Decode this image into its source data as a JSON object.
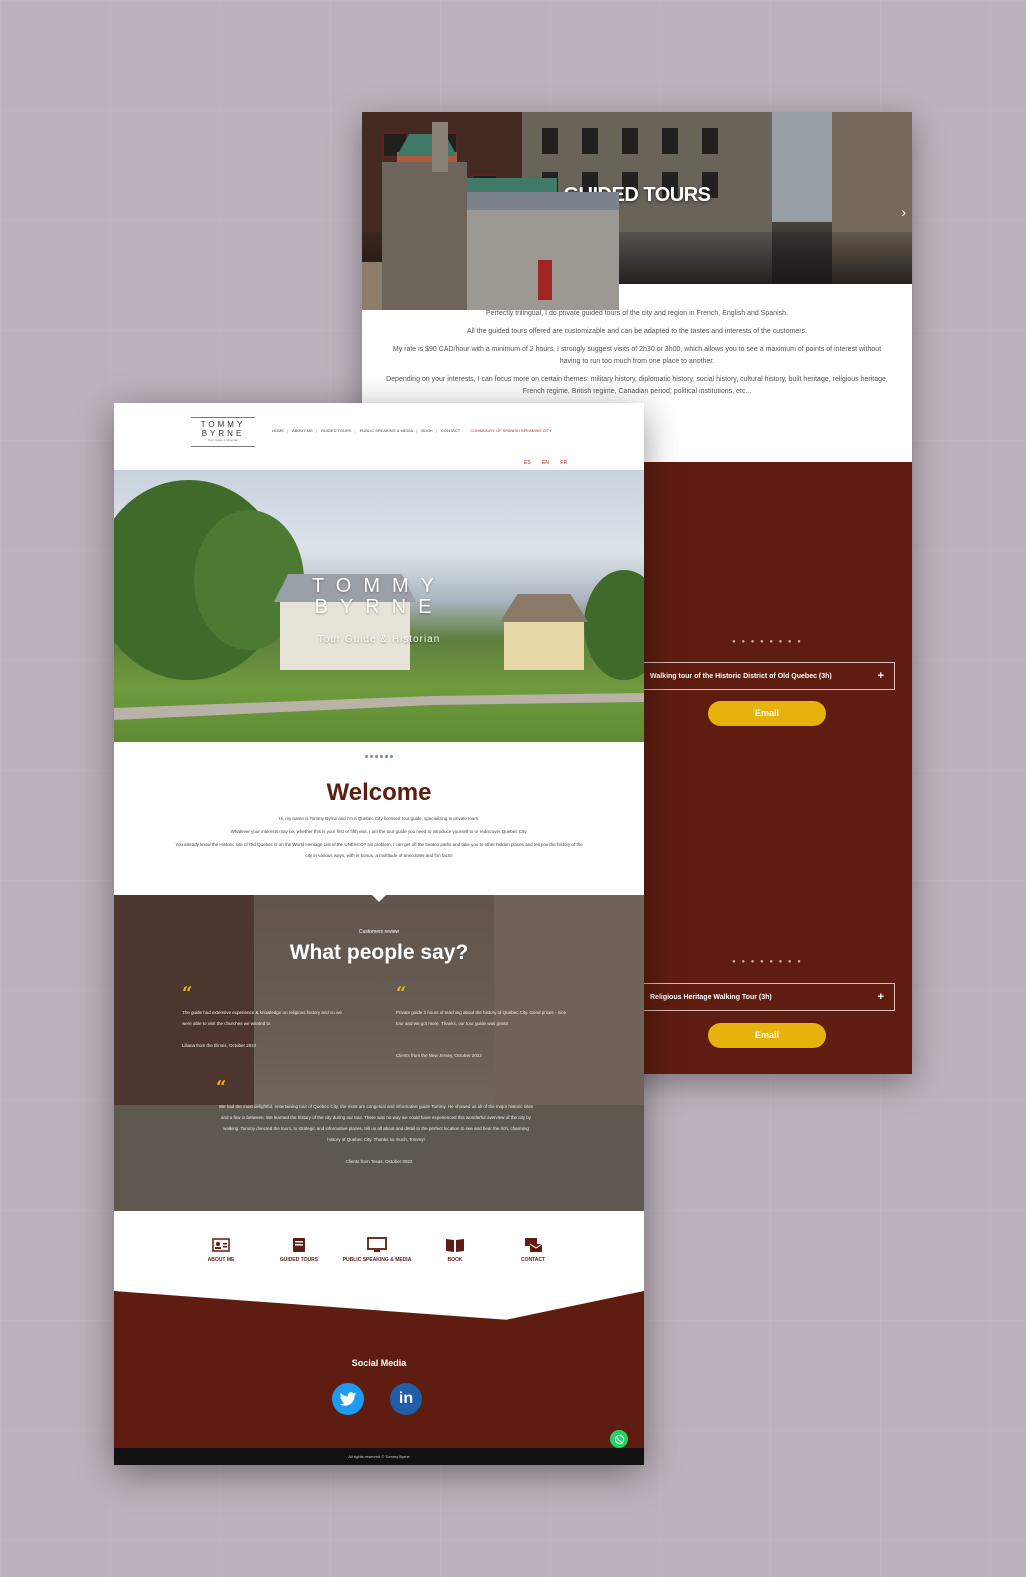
{
  "back_page": {
    "hero_title": "GUIDED TOURS",
    "intro": [
      "Perfectly trilingual, I do private guided tours of the city and region in French, English and Spanish.",
      "All the guided tours offered are customizable and can be adapted to the tastes and interests of the customers.",
      "My rate is $90 CAD/hour with a minimum of 2 hours. I strongly suggest visits of 2h30 or 3h00, which allows you to see a maximum of points of interest without having to run too much from one place to another.",
      "Depending on your interests, I can focus more on certain themes: military history, diplomatic history, social history, cultural history, built heritage, religious heritage, French regime, British regime, Canadian period, political institutions, etc..."
    ],
    "tours": [
      {
        "title": "Walking tour of the Historic District of Old Quebec (3h)",
        "button": "Email",
        "dots": "● ● ● ● ● ● ● ●"
      },
      {
        "title": "Religious Heritage Walking Tour (3h)",
        "button": "Email",
        "dots": "● ● ● ● ● ● ● ●"
      }
    ],
    "next_arrow": "›",
    "plus": "+"
  },
  "front_page": {
    "logo": {
      "line1": "TOMMY",
      "line2": "BYRNE",
      "line3": "Tour Guide & Historian"
    },
    "menu": [
      "HOME",
      "ABOUT ME",
      "GUIDED TOURS",
      "PUBLIC SPEAKING & MEDIA",
      "BOOK",
      "CONTACT"
    ],
    "menu_highlight": "COMMUNITY OF SPANISH SPEAKING CITY",
    "languages": [
      "ES",
      "EN",
      "FR"
    ],
    "hero": {
      "line1": "TOMMY",
      "line2": "BYRNE",
      "subtitle": "Tour Guide & Historian"
    },
    "welcome_title": "Welcome",
    "welcome_text": [
      "Hi, my name is Tommy Byrne and I'm a Quebec City licensed tour guide, specializing in private tours.",
      "Whatever your interests may be, whether this is your first or fifth visit, I am the tour guide you need to introduce yourself to or rediscover Quebec City.",
      "You already know the Historic site of Old Quebec is on the World Heritage List of the UNESCO? No problem, I can get off the beaten paths and take you to other hidden places and tell you the history of the city in various ways, with in bonus, a multitude of anecdotes and fun facts!"
    ],
    "reviews_kicker": "Customers review",
    "reviews_title": "What people say?",
    "reviews": [
      {
        "text": "The guide had extensive experience & knowledge on religious history and so we were able to visit the churches we wanted to.",
        "author": "Liliana from the Illinois, October 2022"
      },
      {
        "text": "Private guide 3 hours of teaching about the history of Quebec City. Good prices - nice tour and we got more. Thanks, our tour guide was great!",
        "author": "Clients from the New Jersey, October 2022"
      },
      {
        "text": "We had the most delightful, entertaining tour of Quebec City, the most are congenial and informative guide Tommy. He showed us all of the major historic sites and a few in between. We learned the history of the city during our tour. There was no way we could have experienced this wonderful overview of the city by walking. Tommy directed the tours, to strategic and informative places, tell us all about and detail to the perfect location to see and hear the rich, charming history of Quebec City. Thanks so much, Tommy!",
        "author": "Clients from Texas, October 2022"
      }
    ],
    "quote_glyph": "“",
    "nav_icons": [
      {
        "label": "ABOUT ME",
        "icon": "id-card-icon"
      },
      {
        "label": "GUIDED TOURS",
        "icon": "book-closed-icon"
      },
      {
        "label": "PUBLIC SPEAKING & MEDIA",
        "icon": "monitor-icon"
      },
      {
        "label": "BOOK",
        "icon": "open-book-icon"
      },
      {
        "label": "CONTACT",
        "icon": "contact-icon"
      }
    ],
    "social_title": "Social Media",
    "social": [
      {
        "name": "twitter-icon"
      },
      {
        "name": "linkedin-icon",
        "label": "in"
      }
    ],
    "copyright": "All rights reserved © Tommy Byrne",
    "colors": {
      "brand_brown": "#5e1d10",
      "accent_yellow": "#e8b20d",
      "link_red": "#b0271a"
    }
  }
}
